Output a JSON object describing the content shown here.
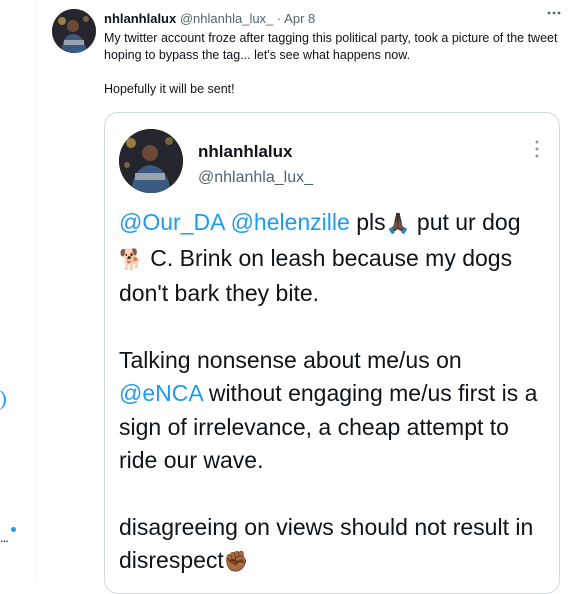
{
  "rail": {
    "dots": "..."
  },
  "tweet": {
    "author_name": "nhlanhlalux",
    "author_handle": "@nhlanhla_lux_",
    "separator": "·",
    "date": "Apr 8",
    "more_icon": "more-horizontal-icon",
    "text_line1": "My twitter account froze after tagging this political party, took a picture of the tweet hoping to bypass the tag... let's see what happens now.",
    "text_line2": "Hopefully it will be sent!"
  },
  "quote": {
    "name": "nhlanhlalux",
    "handle": "@nhlanhla_lux_",
    "more_icon": "more-vertical-icon",
    "para1": {
      "mention1": "@Our_DA",
      "mention2": "@helenzille",
      "text_a": " pls",
      "emoji_pray": "🙏🏿",
      "text_b": " put ur dog ",
      "emoji_dog": "🐕",
      "text_c": " C. Brink on leash because my dogs don't bark they bite."
    },
    "para2": {
      "text_a": "Talking nonsense about me/us on ",
      "mention": "@eNCA",
      "text_b": " without engaging me/us first is a sign of irrelevance, a cheap attempt to ride our wave."
    },
    "para3": {
      "text": "disagreeing on views should not result in disrespect",
      "emoji_fist": "✊🏾"
    }
  },
  "colors": {
    "link": "#1d9bf0",
    "secondary_text": "#536471",
    "border": "#cfd9de"
  }
}
